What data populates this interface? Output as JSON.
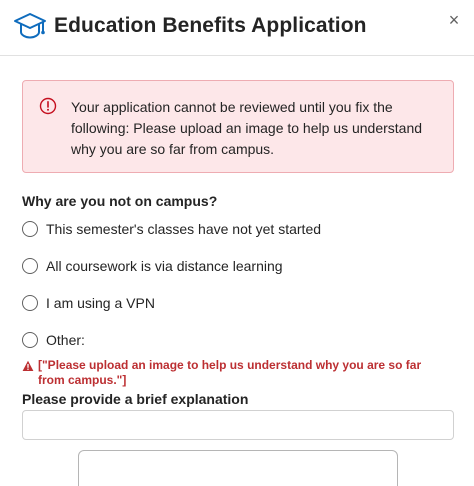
{
  "header": {
    "title": "Education Benefits Application",
    "close_glyph": "×",
    "icon": "graduation-cap-icon",
    "icon_color": "#0f6cbd"
  },
  "alert": {
    "message": "Your application cannot be reviewed until you fix the following: Please upload an image to help us understand why you are so far from campus.",
    "icon": "error-circle-icon",
    "background": "#fde7e9",
    "border": "#eeacb2",
    "icon_color": "#c50f1f"
  },
  "question": {
    "label": "Why are you not on campus?",
    "options": [
      {
        "label": "This semester's classes have not yet started",
        "selected": false
      },
      {
        "label": "All coursework is via distance learning",
        "selected": false
      },
      {
        "label": "I am using a VPN",
        "selected": false
      },
      {
        "label": "Other:",
        "selected": false
      }
    ]
  },
  "validation_error": {
    "text": "[\"Please upload an image to help us understand why you are so far from campus.\"]",
    "icon": "warning-triangle-icon",
    "color": "#bc2f32"
  },
  "explanation": {
    "label": "Please provide a brief explanation",
    "value": "",
    "placeholder": ""
  }
}
